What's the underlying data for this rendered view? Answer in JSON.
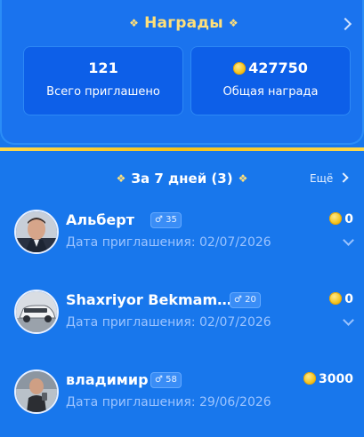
{
  "header": {
    "title": "Награды"
  },
  "stats": {
    "invited_value": "121",
    "invited_label": "Всего приглашено",
    "reward_value": "427750",
    "reward_label": "Общая награда"
  },
  "section": {
    "title": "За 7 дней (3)",
    "more_label": "Ещё"
  },
  "invites": [
    {
      "name": "Альберт",
      "badge": "♂ 35",
      "date": "Дата приглашения: 02/07/2026",
      "reward": "0"
    },
    {
      "name": "Shaxriyor Bekmam…",
      "badge": "♂ 20",
      "date": "Дата приглашения: 02/07/2026",
      "reward": "0"
    },
    {
      "name": "владимир",
      "badge": "♂ 58",
      "date": "Дата приглашения: 29/06/2026",
      "reward": "3000"
    }
  ],
  "colors": {
    "background": "#1877ec",
    "title_gold": "#ffe07a",
    "coin": "#f3c21b",
    "date_text": "#9cc4ff",
    "divider": "#f4c21a"
  }
}
